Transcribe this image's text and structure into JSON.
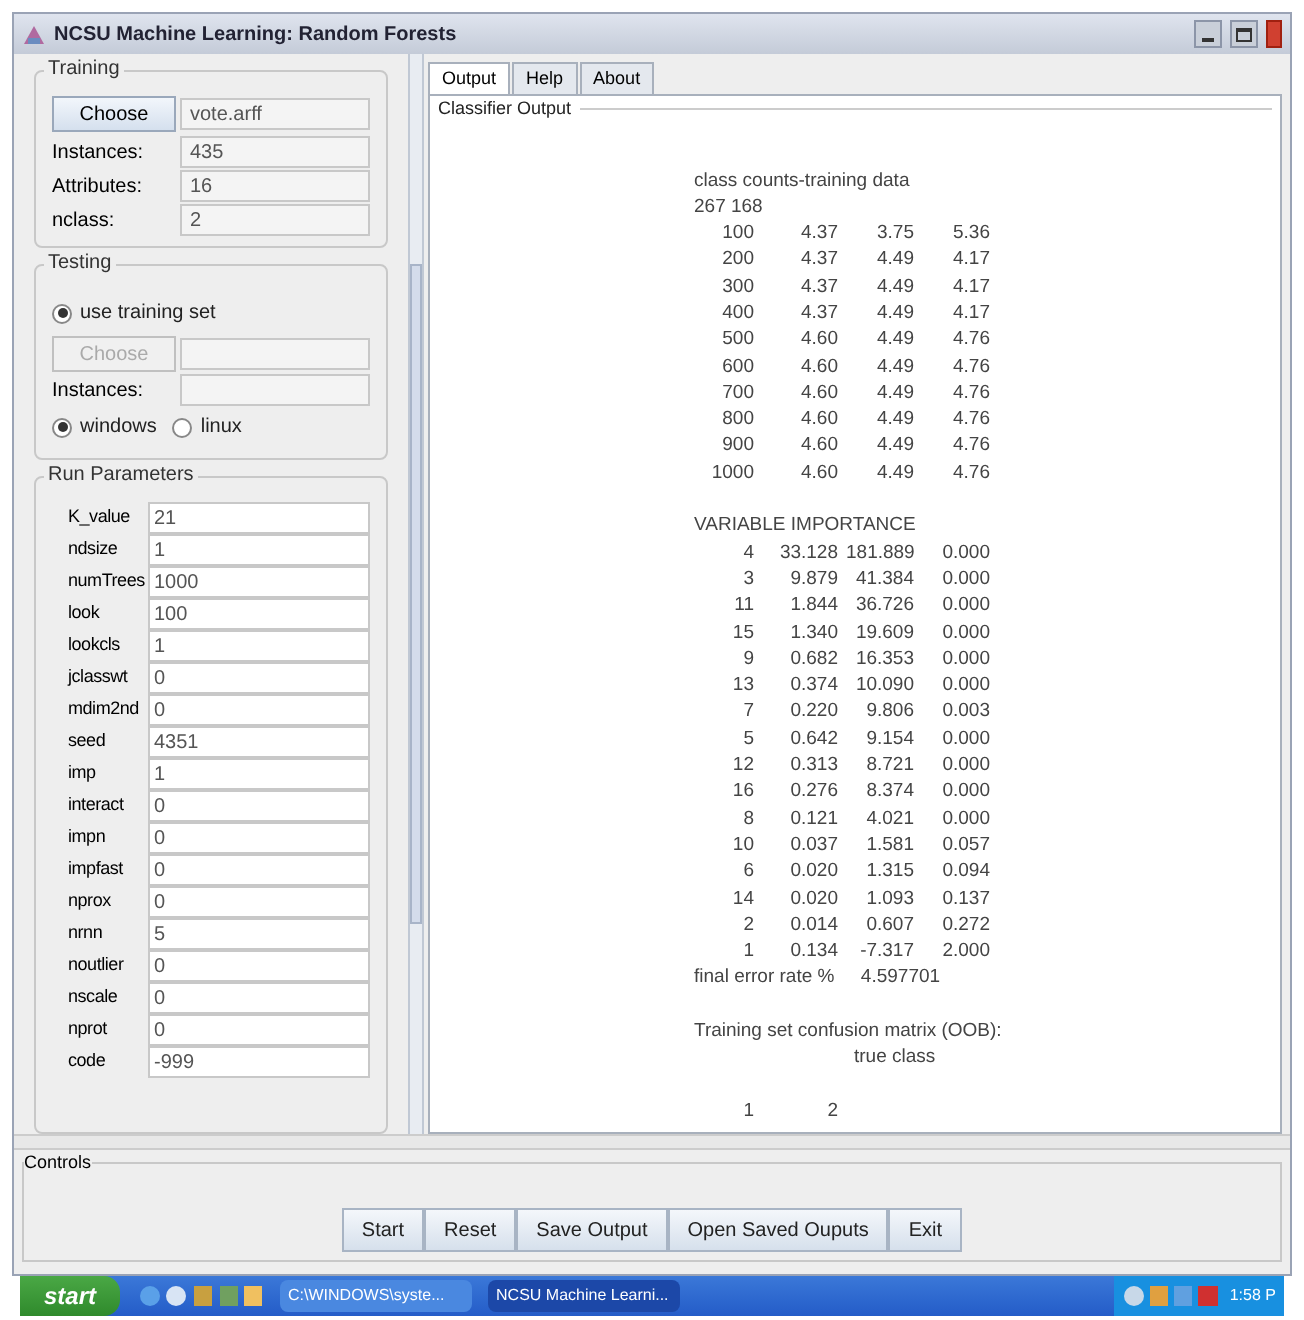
{
  "window": {
    "title": "NCSU Machine Learning: Random Forests"
  },
  "training": {
    "title": "Training",
    "choose_button": "Choose",
    "file": "vote.arff",
    "fields": [
      {
        "label": "Instances:",
        "value": "435"
      },
      {
        "label": "Attributes:",
        "value": "16"
      },
      {
        "label": "nclass:",
        "value": "2"
      }
    ]
  },
  "testing": {
    "title": "Testing",
    "options": [
      {
        "label": "use training set",
        "selected": true
      }
    ],
    "choose_button": {
      "label": "Choose",
      "disabled": true
    },
    "instances_label": "Instances:",
    "os_options": [
      {
        "label": "windows",
        "selected": true
      },
      {
        "label": "linux",
        "selected": false
      }
    ]
  },
  "run_parameters": {
    "title": "Run Parameters",
    "fields": [
      {
        "label": "K_value",
        "value": "21"
      },
      {
        "label": "ndsize",
        "value": "1"
      },
      {
        "label": "numTrees",
        "value": "1000"
      },
      {
        "label": "look",
        "value": "100"
      },
      {
        "label": "lookcls",
        "value": "1"
      },
      {
        "label": "jclasswt",
        "value": "0"
      },
      {
        "label": "mdim2nd",
        "value": "0"
      },
      {
        "label": "seed",
        "value": "4351"
      },
      {
        "label": "imp",
        "value": "1"
      },
      {
        "label": "interact",
        "value": "0"
      },
      {
        "label": "impn",
        "value": "0"
      },
      {
        "label": "impfast",
        "value": "0"
      },
      {
        "label": "nprox",
        "value": "0"
      },
      {
        "label": "nrnn",
        "value": "5"
      },
      {
        "label": "noutlier",
        "value": "0"
      },
      {
        "label": "nscale",
        "value": "0"
      },
      {
        "label": "nprot",
        "value": "0"
      },
      {
        "label": "code",
        "value": "-999"
      }
    ]
  },
  "tabs": [
    {
      "label": "Output",
      "selected": true
    },
    {
      "label": "Help",
      "selected": false
    },
    {
      "label": "About",
      "selected": false
    }
  ],
  "output": {
    "title": "Classifier Output",
    "lines": [
      {
        "kind": "text",
        "text": "class counts-training data"
      },
      {
        "kind": "text",
        "text": "267 168"
      },
      {
        "kind": "row",
        "cells": [
          "100",
          "4.37",
          "3.75",
          "5.36"
        ]
      },
      {
        "kind": "row",
        "cells": [
          "200",
          "4.37",
          "4.49",
          "4.17"
        ]
      },
      {
        "kind": "row",
        "cells": [
          "300",
          "4.37",
          "4.49",
          "4.17"
        ]
      },
      {
        "kind": "row",
        "cells": [
          "400",
          "4.37",
          "4.49",
          "4.17"
        ]
      },
      {
        "kind": "row",
        "cells": [
          "500",
          "4.60",
          "4.49",
          "4.76"
        ]
      },
      {
        "kind": "row",
        "cells": [
          "600",
          "4.60",
          "4.49",
          "4.76"
        ]
      },
      {
        "kind": "row",
        "cells": [
          "700",
          "4.60",
          "4.49",
          "4.76"
        ]
      },
      {
        "kind": "row",
        "cells": [
          "800",
          "4.60",
          "4.49",
          "4.76"
        ]
      },
      {
        "kind": "row",
        "cells": [
          "900",
          "4.60",
          "4.49",
          "4.76"
        ]
      },
      {
        "kind": "row",
        "cells": [
          "1000",
          "4.60",
          "4.49",
          "4.76"
        ]
      },
      {
        "kind": "blank"
      },
      {
        "kind": "text",
        "text": "VARIABLE IMPORTANCE"
      },
      {
        "kind": "row",
        "cells": [
          "4",
          "33.128",
          "181.889",
          "0.000"
        ]
      },
      {
        "kind": "row",
        "cells": [
          "3",
          "9.879",
          "41.384",
          "0.000"
        ]
      },
      {
        "kind": "row",
        "cells": [
          "11",
          "1.844",
          "36.726",
          "0.000"
        ]
      },
      {
        "kind": "row",
        "cells": [
          "15",
          "1.340",
          "19.609",
          "0.000"
        ]
      },
      {
        "kind": "row",
        "cells": [
          "9",
          "0.682",
          "16.353",
          "0.000"
        ]
      },
      {
        "kind": "row",
        "cells": [
          "13",
          "0.374",
          "10.090",
          "0.000"
        ]
      },
      {
        "kind": "row",
        "cells": [
          "7",
          "0.220",
          "9.806",
          "0.003"
        ]
      },
      {
        "kind": "row",
        "cells": [
          "5",
          "0.642",
          "9.154",
          "0.000"
        ]
      },
      {
        "kind": "row",
        "cells": [
          "12",
          "0.313",
          "8.721",
          "0.000"
        ]
      },
      {
        "kind": "row",
        "cells": [
          "16",
          "0.276",
          "8.374",
          "0.000"
        ]
      },
      {
        "kind": "row",
        "cells": [
          "8",
          "0.121",
          "4.021",
          "0.000"
        ]
      },
      {
        "kind": "row",
        "cells": [
          "10",
          "0.037",
          "1.581",
          "0.057"
        ]
      },
      {
        "kind": "row",
        "cells": [
          "6",
          "0.020",
          "1.315",
          "0.094"
        ]
      },
      {
        "kind": "row",
        "cells": [
          "14",
          "0.020",
          "1.093",
          "0.137"
        ]
      },
      {
        "kind": "row",
        "cells": [
          "2",
          "0.014",
          "0.607",
          "0.272"
        ]
      },
      {
        "kind": "row",
        "cells": [
          "1",
          "0.134",
          "-7.317",
          "2.000"
        ]
      },
      {
        "kind": "text",
        "text": "final error rate %     4.597701"
      },
      {
        "kind": "blank"
      },
      {
        "kind": "text",
        "text": "Training set confusion matrix (OOB):"
      },
      {
        "kind": "indent",
        "text": "true class"
      },
      {
        "kind": "blank"
      },
      {
        "kind": "row",
        "cells": [
          "1",
          "2"
        ]
      }
    ]
  },
  "controls": {
    "title": "Controls",
    "buttons": [
      "Start",
      "Reset",
      "Save Output",
      "Open Saved Ouputs",
      "Exit"
    ]
  },
  "taskbar": {
    "start": "start",
    "tasks": [
      {
        "label": "C:\\WINDOWS\\syste...",
        "selected": false
      },
      {
        "label": "NCSU Machine Learni...",
        "selected": true
      }
    ],
    "clock": "1:58 P"
  }
}
